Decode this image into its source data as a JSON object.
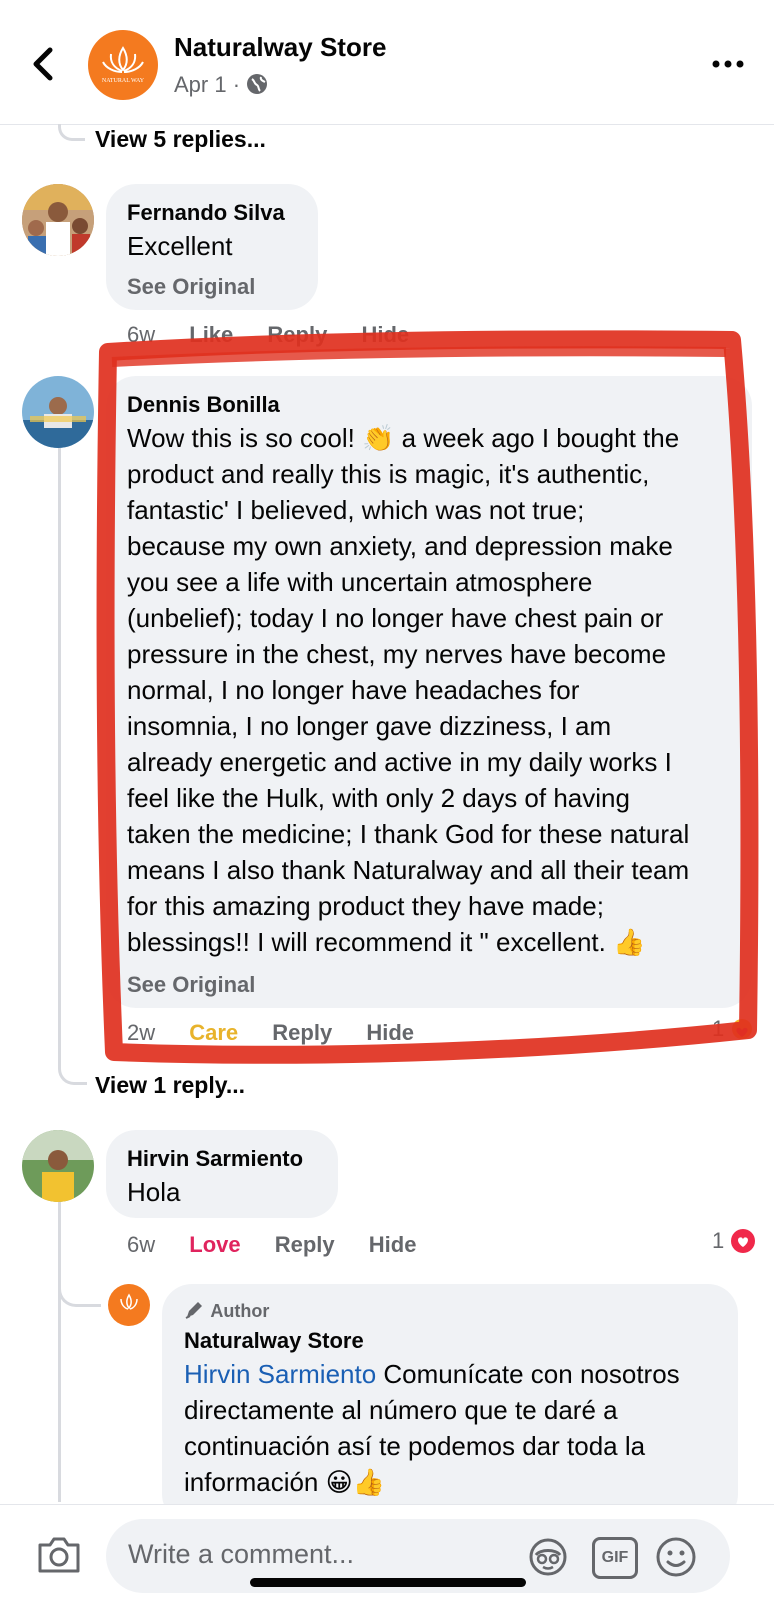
{
  "header": {
    "page_name": "Naturalway Store",
    "date": "Apr 1 ·",
    "avatar_text": "NATURAL WAY"
  },
  "thread": {
    "view_replies_top": "View 5 replies...",
    "view_replies_mid": "View 1 reply..."
  },
  "comments": [
    {
      "name": "Fernando Silva",
      "text": "Excellent",
      "see_original": "See Original",
      "time": "6w",
      "like": "Like",
      "reply": "Reply",
      "hide": "Hide"
    },
    {
      "name": "Dennis Bonilla",
      "lines": [
        "Wow this is so cool! 👏 a week ago I bought the",
        "product and really this is magic, it's authentic,",
        "fantastic' I believed, which was not true;",
        "because my own anxiety, and depression make",
        "you see a life with uncertain atmosphere",
        "(unbelief); today I no longer have chest pain or",
        "pressure in the chest, my nerves have become",
        "normal, I no longer have headaches for",
        "insomnia, I no longer gave dizziness, I am",
        "already energetic and active in my daily works I",
        "feel like the Hulk, with only 2 days of having",
        "taken the medicine; I thank God for these natural",
        "means I also thank Naturalway and all their team",
        "for this amazing product they have made;",
        "blessings!! I will recommend it \" excellent. 👍"
      ],
      "see_original": "See Original",
      "time": "2w",
      "reaction_label": "Care",
      "reply": "Reply",
      "hide": "Hide",
      "reaction_count": "1"
    },
    {
      "name": "Hirvin Sarmiento",
      "text": "Hola",
      "time": "6w",
      "reaction_label": "Love",
      "reply": "Reply",
      "hide": "Hide",
      "reaction_count": "1"
    }
  ],
  "reply": {
    "badge": "Author",
    "name": "Naturalway Store",
    "mention": "Hirvin Sarmiento",
    "lines": [
      "Comunícate con nosotros",
      "directamente al número que te daré a",
      "continuación así te podemos dar toda la",
      "información 😀👍"
    ]
  },
  "composer": {
    "placeholder": "Write a comment...",
    "gif_label": "GIF"
  },
  "colors": {
    "highlight": "#e0301e",
    "care": "#e8b32b",
    "love": "#e0245e",
    "link": "#1a5fb4",
    "brand": "#f47a1f"
  }
}
